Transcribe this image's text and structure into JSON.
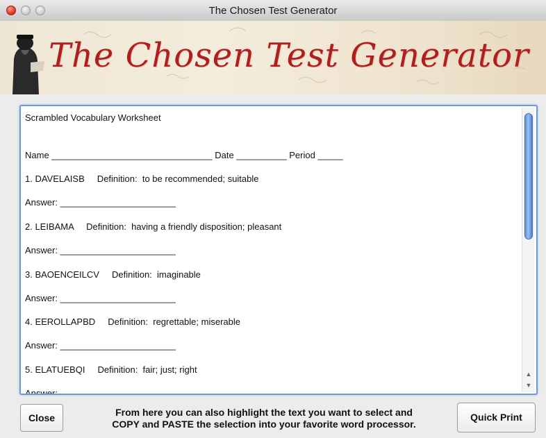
{
  "window": {
    "title": "The Chosen Test Generator"
  },
  "banner": {
    "title": "The Chosen Test Generator"
  },
  "worksheet": {
    "lines": [
      "Scrambled Vocabulary Worksheet",
      "Name ________________________________ Date __________ Period _____",
      "1. DAVELAISB     Definition:  to be recommended; suitable",
      "Answer: _______________________",
      "2. LEIBAMA     Definition:  having a friendly disposition; pleasant",
      "Answer: _______________________",
      "3. BAOENCEILCV     Definition:  imaginable",
      "Answer: _______________________",
      "4. EEROLLAPBD     Definition:  regrettable; miserable",
      "Answer: _______________________",
      "5. ELATUEBQI     Definition:  fair; just; right",
      "Answer: _______________________"
    ]
  },
  "scrollbar": {
    "up_icon": "▲",
    "down_icon": "▼"
  },
  "footer": {
    "close_label": "Close",
    "help_line1": "From here you can also highlight the text you want to select and",
    "help_line2": "COPY and PASTE the selection into your favorite word processor.",
    "print_label": "Quick Print"
  }
}
